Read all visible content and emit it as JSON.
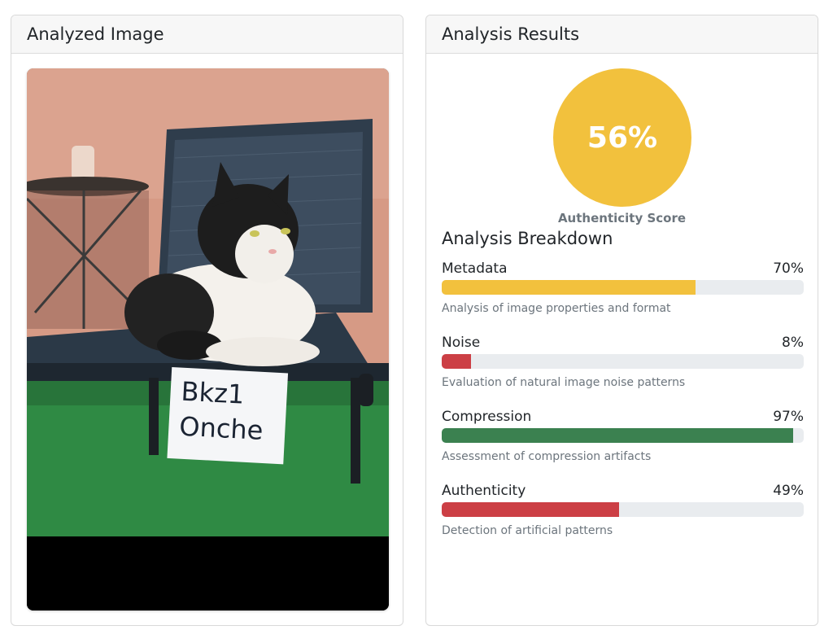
{
  "left_card": {
    "title": "Analyzed Image",
    "image_label": "cat-on-chair-photo",
    "sign_line1": "Bkz1",
    "sign_line2": "Onche"
  },
  "right_card": {
    "title": "Analysis Results",
    "score": {
      "value": "56%",
      "fraction": 0.56,
      "label": "Authenticity Score",
      "color": "#f2c13d"
    },
    "breakdown_title": "Analysis Breakdown",
    "metrics": [
      {
        "name": "Metadata",
        "value": "70%",
        "fraction": 0.7,
        "color": "#f2c13d",
        "description": "Analysis of image properties and format"
      },
      {
        "name": "Noise",
        "value": "8%",
        "fraction": 0.08,
        "color": "#cc3f45",
        "description": "Evaluation of natural image noise patterns"
      },
      {
        "name": "Compression",
        "value": "97%",
        "fraction": 0.97,
        "color": "#3b8150",
        "description": "Assessment of compression artifacts"
      },
      {
        "name": "Authenticity",
        "value": "49%",
        "fraction": 0.49,
        "color": "#cc3f45",
        "description": "Detection of artificial patterns"
      }
    ]
  }
}
